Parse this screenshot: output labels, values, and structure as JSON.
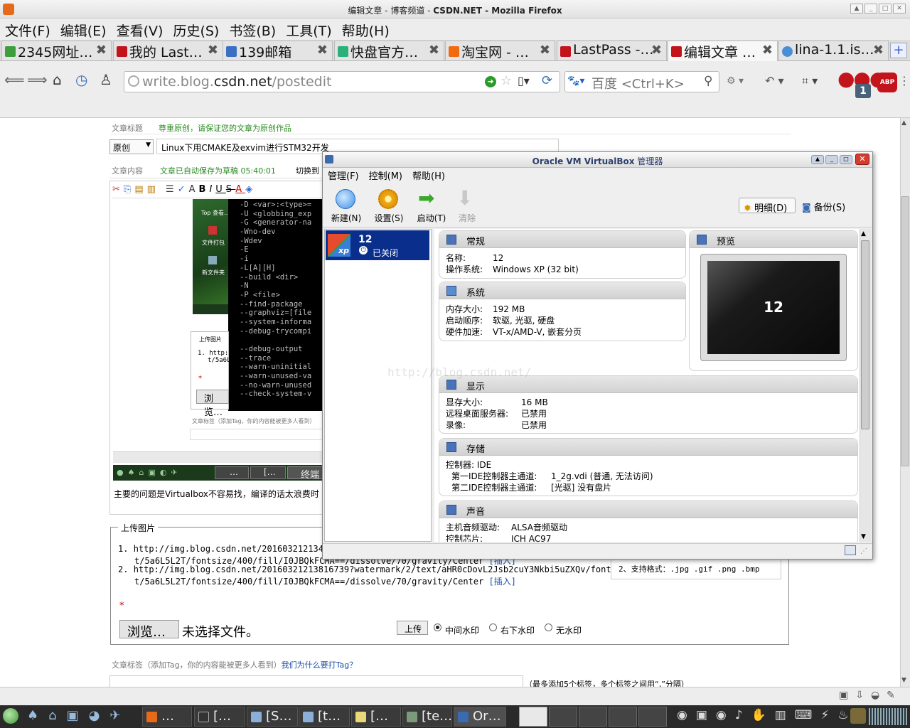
{
  "firefox": {
    "title_pre": "编辑文章 - 博客频道 - ",
    "title_bold": "CSDN.NET - Mozilla Firefox",
    "menu": [
      "文件(F)",
      "编辑(E)",
      "查看(V)",
      "历史(S)",
      "书签(B)",
      "工具(T)",
      "帮助(H)"
    ],
    "tabs": [
      "2345网址…",
      "我的 Last…",
      "139邮箱",
      "快盘官方…",
      "淘宝网 - …",
      "LastPass -…",
      "编辑文章 …",
      "lina-1.1.is…"
    ],
    "url_prefix": "write.blog.",
    "url_domain": "csdn.net",
    "url_path": "/postedit",
    "search_placeholder": "百度 <Ctrl+K>",
    "abp": "ABP",
    "lastpass_badge": "1",
    "colors": {
      "accent": "#c4141b",
      "url_green": "#2a9a2a"
    }
  },
  "page": {
    "title_label": "文章标题",
    "title_notice": "尊重原创，请保证您的文章为原创作品",
    "type_select": "原创",
    "title_value": "Linux下用CMAKE及exvim进行STM32开发",
    "content_label": "文章内容",
    "autosave": "文章已自动保存为草稿  05:40:01",
    "switch_to": "切换到",
    "term_lines": [
      "-D <var>:<type>=",
      "-U <globbing_exp",
      "-G <generator-na",
      "-Wno-dev",
      "-Wdev",
      "-E",
      "-i",
      "-L[A][H]",
      "--build <dir>",
      "-N",
      "-P <file>",
      "--find-package",
      "--graphviz=[file",
      "--system-informa",
      "--debug-trycompi",
      "",
      "--debug-output",
      "--trace",
      "--warn-uninitial",
      "--warn-unused-va",
      "--no-warn-unused",
      "--check-system-v"
    ],
    "desk_labels": [
      "Top 查看…",
      "文件打包",
      "新文件夹"
    ],
    "inner_upload_label": "上传图片",
    "inner_upload_line1": "1. http:/",
    "inner_upload_line2": "t/5a6L",
    "inner_browse": "浏览…",
    "inner_tags": "文章标签（添加Tag，你的内容能被更多人看到）",
    "inner_task": [
      "…",
      "[…",
      "终端"
    ],
    "body_text": "主要的问题是Virtualbox不容易找，编译的话太浪费时",
    "upload_legend": "上传图片",
    "upload_links": [
      {
        "n": "1.",
        "url1": "http://img.blog.csdn.net/2016032121344",
        "url2": "t/5a6L5L2T/fontsize/400/fill/I0JBQkFCMA==/dissolve/70/gravity/Center",
        "insert": "[插入]"
      },
      {
        "n": "2.",
        "url1": "http://img.blog.csdn.net/20160321213816739?watermark/2/text/aHR0cDovL2Jsb2cuY3Nkbi5uZXQv/font",
        "url2": "t/5a6L5L2T/fontsize/400/fill/I0JBQkFCMA==/dissolve/70/gravity/Center",
        "insert": "[插入]"
      }
    ],
    "formats_note": "2、支持格式：.jpg .gif .png .bmp",
    "required": "*",
    "browse": "浏览…",
    "no_file": "未选择文件。",
    "upload_btn": "上传",
    "watermark_opts": [
      "中间水印",
      "右下水印",
      "无水印"
    ],
    "watermark_selected": 0,
    "tags_label": "文章标签（添加Tag，你的内容能被更多人看到）",
    "tags_link": "我们为什么要打Tag？",
    "tags_hint": "（最多添加5个标签，多个标签之间用“,”分隔）",
    "watermark_overlay": "http://blog.csdn.net/"
  },
  "vbox": {
    "title_bold": "Oracle VM VirtualBox",
    "title_rest": " 管理器",
    "menu": [
      "管理(F)",
      "控制(M)",
      "帮助(H)"
    ],
    "toolbar": [
      {
        "label": "新建(N)",
        "icon": "new-icon"
      },
      {
        "label": "设置(S)",
        "icon": "settings-gear-icon"
      },
      {
        "label": "启动(T)",
        "icon": "start-arrow-icon"
      },
      {
        "label": "清除",
        "icon": "discard-arrow-icon"
      }
    ],
    "view_details": "明细(D)",
    "view_snapshots": "备份(S)",
    "vm": {
      "name": "12",
      "state": "已关闭",
      "os_badge": "xp"
    },
    "general": {
      "head": "常规",
      "name_k": "名称:",
      "name_v": "12",
      "os_k": "操作系统:",
      "os_v": "Windows XP (32 bit)"
    },
    "system": {
      "head": "系统",
      "mem_k": "内存大小:",
      "mem_v": "192 MB",
      "boot_k": "启动顺序:",
      "boot_v": "软驱, 光驱, 硬盘",
      "accel_k": "硬件加速:",
      "accel_v": "VT-x/AMD-V, 嵌套分页"
    },
    "preview": {
      "head": "预览",
      "screen_text": "12"
    },
    "display": {
      "head": "显示",
      "vram_k": "显存大小:",
      "vram_v": "16 MB",
      "rdp_k": "远程桌面服务器:",
      "rdp_v": "已禁用",
      "rec_k": "录像:",
      "rec_v": "已禁用"
    },
    "storage": {
      "head": "存储",
      "ctrl": "控制器: IDE",
      "p1_k": "第一IDE控制器主通道:",
      "p1_v": "1_2g.vdi (普通, 无法访问)",
      "p2_k": "第二IDE控制器主通道:",
      "p2_v": "[光驱] 没有盘片"
    },
    "audio": {
      "head": "声音",
      "drv_k": "主机音频驱动:",
      "drv_v": "ALSA音频驱动",
      "chip_k": "控制芯片:",
      "chip_v": "ICH AC97"
    }
  },
  "taskbar": {
    "items": [
      "…",
      "[…",
      "[S…",
      "[t…",
      "[…",
      "[te…",
      "Or…",
      ""
    ]
  }
}
